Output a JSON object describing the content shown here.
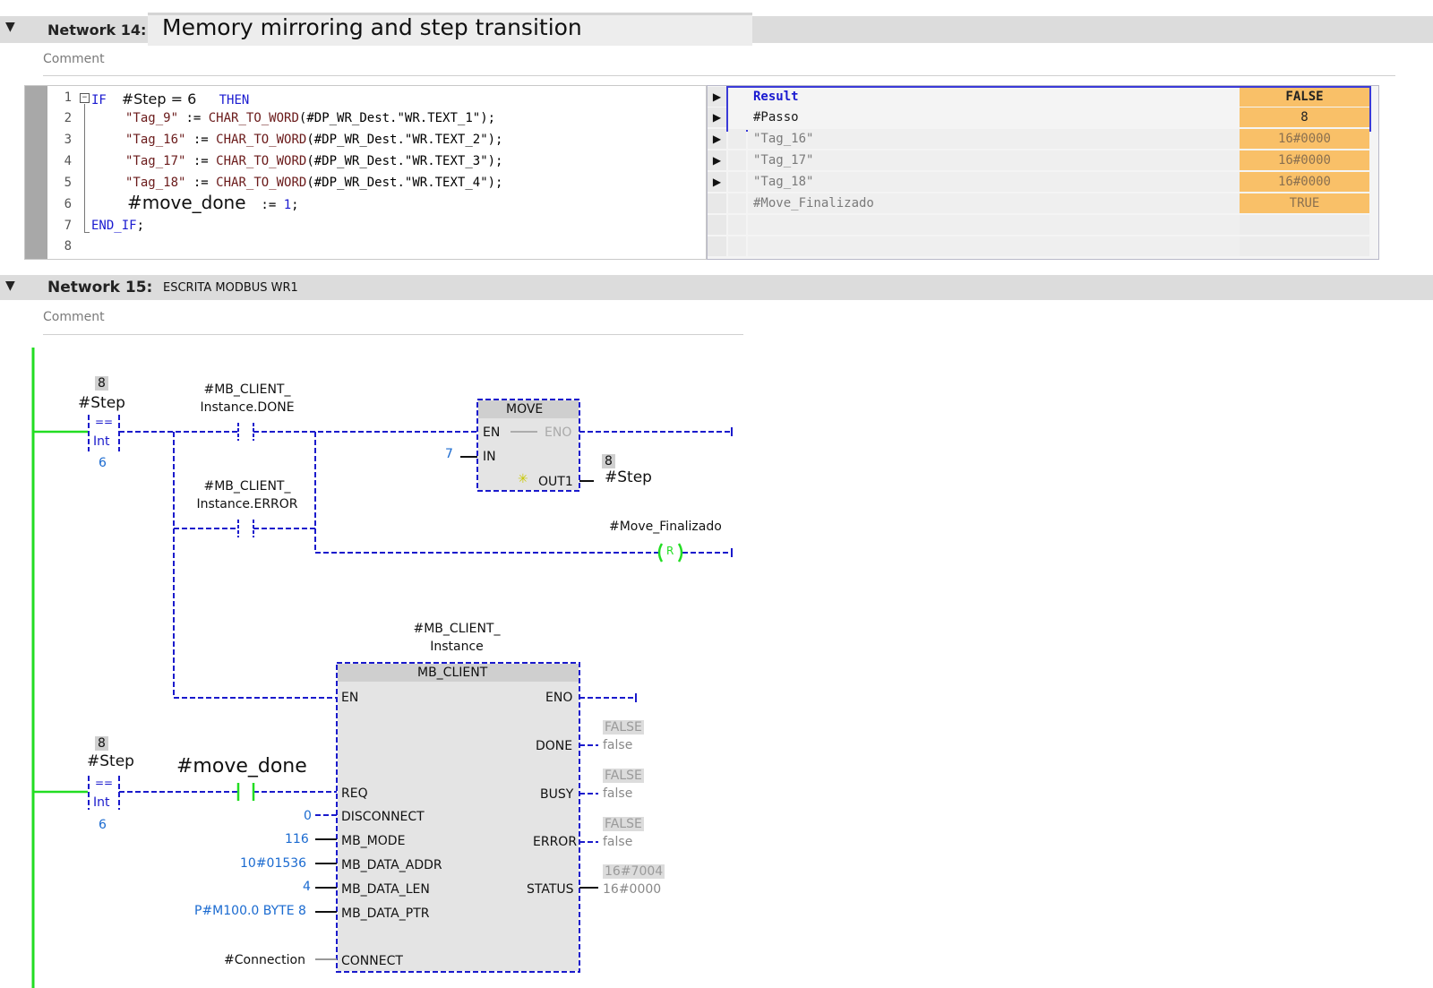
{
  "network14": {
    "label": "Network 14:",
    "title": "Memory mirroring and step transition",
    "comment": "Comment",
    "code": {
      "line_numbers": [
        "1",
        "2",
        "3",
        "4",
        "5",
        "6",
        "7",
        "8"
      ],
      "l1": {
        "kw_if": "IF",
        "cond": "#Step = 6",
        "kw_then": "THEN"
      },
      "l2": {
        "lhs": "\"Tag_9\"",
        "op": ":=",
        "fn": "CHAR_TO_WORD",
        "arg": "(#DP_WR_Dest.\"WR.TEXT_1\");"
      },
      "l3": {
        "lhs": "\"Tag_16\"",
        "op": ":=",
        "fn": "CHAR_TO_WORD",
        "arg": "(#DP_WR_Dest.\"WR.TEXT_2\");"
      },
      "l4": {
        "lhs": "\"Tag_17\"",
        "op": ":=",
        "fn": "CHAR_TO_WORD",
        "arg": "(#DP_WR_Dest.\"WR.TEXT_3\");"
      },
      "l5": {
        "lhs": "\"Tag_18\"",
        "op": ":=",
        "fn": "CHAR_TO_WORD",
        "arg": "(#DP_WR_Dest.\"WR.TEXT_4\");"
      },
      "l6": {
        "lhs": "#move_done",
        "op": ":=",
        "val": "1",
        "end": ";"
      },
      "l7": {
        "kw": "END_IF",
        "end": ";"
      }
    },
    "watch": [
      {
        "name": "Result",
        "value": "FALSE"
      },
      {
        "name": "#Passo",
        "value": "8"
      },
      {
        "name": "\"Tag_16\"",
        "value": "16#0000"
      },
      {
        "name": "\"Tag_17\"",
        "value": "16#0000"
      },
      {
        "name": "\"Tag_18\"",
        "value": "16#0000"
      },
      {
        "name": "#Move_Finalizado",
        "value": "TRUE"
      }
    ]
  },
  "network15": {
    "label": "Network 15:",
    "title": "ESCRITA MODBUS WR1",
    "comment": "Comment",
    "cmp1": {
      "value": "8",
      "tag": "#Step",
      "op": "==",
      "type": "Int",
      "const": "6"
    },
    "contact_done": {
      "line1": "#MB_CLIENT_",
      "line2": "Instance.DONE"
    },
    "contact_error": {
      "line1": "#MB_CLIENT_",
      "line2": "Instance.ERROR"
    },
    "move": {
      "title": "MOVE",
      "en": "EN",
      "eno": "ENO",
      "in_pin": "IN",
      "in_val": "7",
      "out_pin": "OUT1",
      "out_value": "8",
      "out_tag": "#Step"
    },
    "coil": {
      "tag": "#Move_Finalizado",
      "type": "R"
    },
    "mb_instance": {
      "line1": "#MB_CLIENT_",
      "line2": "Instance"
    },
    "mb": {
      "title": "MB_CLIENT",
      "en": "EN",
      "eno": "ENO",
      "req": "REQ",
      "disconnect": "DISCONNECT",
      "mode": "MB_MODE",
      "addr": "MB_DATA_ADDR",
      "len": "MB_DATA_LEN",
      "ptr": "MB_DATA_PTR",
      "connect": "CONNECT",
      "done": "DONE",
      "busy": "BUSY",
      "error": "ERROR",
      "status": "STATUS",
      "disconnect_val": "0",
      "mode_val": "116",
      "addr_val": "10#01536",
      "len_val": "4",
      "ptr_val": "P#M100.0 BYTE 8",
      "connect_val": "#Connection",
      "done_live": "FALSE",
      "done_val": "false",
      "busy_live": "FALSE",
      "busy_val": "false",
      "error_live": "FALSE",
      "error_val": "false",
      "status_live": "16#7004",
      "status_val": "16#0000"
    },
    "cmp2": {
      "value": "8",
      "tag": "#Step",
      "op": "==",
      "type": "Int",
      "const": "6"
    },
    "contact_move": {
      "tag": "#move_done"
    }
  },
  "colors": {
    "power_rail": "#22dd22",
    "wire": "#1a1acc",
    "watch_value": "#f9c068"
  }
}
